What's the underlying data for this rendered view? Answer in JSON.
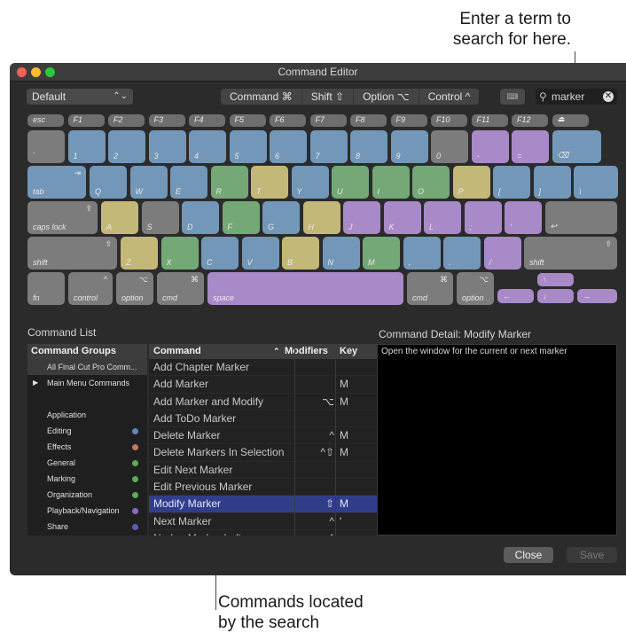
{
  "callouts": {
    "top_line1": "Enter a term to",
    "top_line2": "search for here.",
    "bottom_line1": "Commands located",
    "bottom_line2": "by the search"
  },
  "window": {
    "title": "Command Editor",
    "traffic_lights": [
      "#ff5f57",
      "#febc2e",
      "#28c840"
    ]
  },
  "toolbar": {
    "preset": "Default",
    "modifiers": [
      "Command ⌘",
      "Shift ⇧",
      "Option ⌥",
      "Control ^"
    ],
    "keyboard_button": "⌨",
    "search_value": "marker",
    "search_icon": "magnifier-icon",
    "clear_icon": "clear-icon"
  },
  "keyboard": {
    "row0": [
      "esc",
      "F1",
      "F2",
      "F3",
      "F4",
      "F5",
      "F6",
      "F7",
      "F8",
      "F9",
      "F10",
      "F11",
      "F12",
      "⏏"
    ],
    "row1": [
      "`",
      "1",
      "2",
      "3",
      "4",
      "5",
      "6",
      "7",
      "8",
      "9",
      "0",
      "-",
      "=",
      "⌫"
    ],
    "row2": [
      "tab",
      "Q",
      "W",
      "E",
      "R",
      "T",
      "Y",
      "U",
      "I",
      "O",
      "P",
      "[",
      "]",
      "\\"
    ],
    "row3": [
      "caps lock",
      "A",
      "S",
      "D",
      "F",
      "G",
      "H",
      "J",
      "K",
      "L",
      ";",
      "'",
      "↩"
    ],
    "row4": [
      "shift",
      "Z",
      "X",
      "C",
      "V",
      "B",
      "N",
      "M",
      ",",
      ".",
      "/",
      "shift"
    ],
    "row5": [
      "fn",
      "control",
      "option",
      "cmd",
      "space",
      "cmd",
      "option",
      "←",
      "↑",
      "↓",
      "→"
    ],
    "tops": {
      "tab": "⇥",
      "caps": "⇪",
      "shift": "⇧",
      "control": "^",
      "option": "⌥",
      "cmd": "⌘"
    }
  },
  "command_list": {
    "title": "Command List",
    "groups_header": "Command Groups",
    "groups": [
      {
        "label": "All Final Cut Pro Comm...",
        "dot": ""
      },
      {
        "label": "Main Menu Commands",
        "dot": ""
      },
      {
        "label": "",
        "dot": ""
      },
      {
        "label": "Application",
        "dot": ""
      },
      {
        "label": "Editing",
        "dot": "#5b86c0"
      },
      {
        "label": "Effects",
        "dot": "#c0786a"
      },
      {
        "label": "General",
        "dot": "#5aaa5a"
      },
      {
        "label": "Marking",
        "dot": "#5aaa5a"
      },
      {
        "label": "Organization",
        "dot": "#5aaa5a"
      },
      {
        "label": "Playback/Navigation",
        "dot": "#8a6ac0"
      },
      {
        "label": "Share",
        "dot": "#5a5ac0"
      }
    ],
    "headers": {
      "command": "Command",
      "modifiers": "Modifiers",
      "key": "Key"
    },
    "rows": [
      {
        "command": "Add Chapter Marker",
        "mod": "",
        "key": ""
      },
      {
        "command": "Add Marker",
        "mod": "",
        "key": "M"
      },
      {
        "command": "Add Marker and Modify",
        "mod": "⌥",
        "key": "M"
      },
      {
        "command": "Add ToDo Marker",
        "mod": "",
        "key": ""
      },
      {
        "command": "Delete Marker",
        "mod": "^",
        "key": "M"
      },
      {
        "command": "Delete Markers In Selection",
        "mod": "^⇧",
        "key": "M"
      },
      {
        "command": "Edit Next Marker",
        "mod": "",
        "key": ""
      },
      {
        "command": "Edit Previous Marker",
        "mod": "",
        "key": ""
      },
      {
        "command": "Modify Marker",
        "mod": "⇧",
        "key": "M"
      },
      {
        "command": "Next Marker",
        "mod": "^",
        "key": "'"
      },
      {
        "command": "Nudge Marker Left",
        "mod": "^",
        "key": ","
      }
    ]
  },
  "detail": {
    "title": "Command Detail: Modify Marker",
    "text": "Open the window for the current or next marker"
  },
  "buttons": {
    "close": "Close",
    "save": "Save"
  }
}
